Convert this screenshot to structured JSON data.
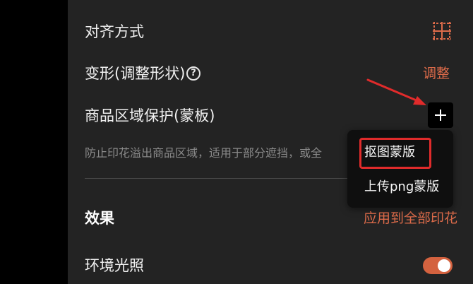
{
  "panel": {
    "alignment_label": "对齐方式",
    "alignment_icon": "align-grid-icon",
    "transform_label": "变形(调整形状)",
    "transform_help_icon": "question-circle-icon",
    "transform_help_glyph": "?",
    "transform_action": "调整",
    "protection_label": "商品区域保护(蒙板)",
    "protection_add_icon": "plus-icon",
    "protection_description": "防止印花溢出商品区域，适用于部分遮挡，或全",
    "effects_title": "效果",
    "effects_apply_all": "应用到全部印花",
    "ambient_light_label": "环境光照",
    "ambient_light_enabled": true
  },
  "dropdown": {
    "items": [
      {
        "label": "抠图蒙版"
      },
      {
        "label": "上传png蒙版"
      }
    ]
  },
  "colors": {
    "panel_bg": "#232323",
    "accent": "#dd6b4a",
    "toggle_on": "#d4623f",
    "annotation_red": "#e02b2b"
  }
}
